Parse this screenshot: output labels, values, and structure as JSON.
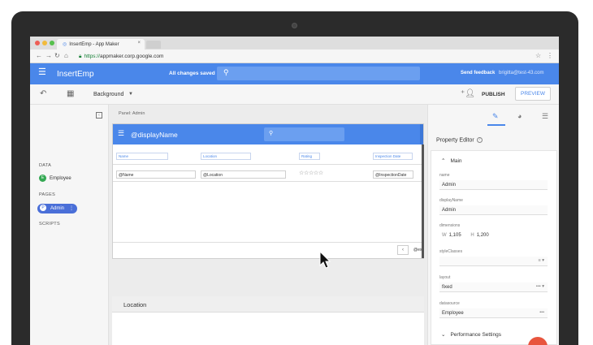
{
  "browser": {
    "tab_title": "InsertEmp - App Maker",
    "tab_icon": "app-maker-icon",
    "tab_close": "×",
    "url_scheme": "https://",
    "url_rest": "appmaker.corp.google.com",
    "traffic_colors": [
      "#ee5e56",
      "#f2bb3b",
      "#56c04d"
    ]
  },
  "app_header": {
    "title": "InsertEmp",
    "status": "All changes saved",
    "feedback": "Send feedback",
    "account": "brigitta@test-43.com",
    "color": "#4a87ea"
  },
  "toolbar": {
    "background_label": "Background",
    "publish": "PUBLISH",
    "preview": "PREVIEW"
  },
  "sidebar": {
    "data_heading": "DATA",
    "data_items": [
      {
        "badge": "E",
        "label": "Employee",
        "badge_color": "#34a853"
      }
    ],
    "pages_heading": "PAGES",
    "page_items": [
      {
        "badge": "P",
        "label": "Admin"
      }
    ],
    "scripts_heading": "SCRIPTS"
  },
  "canvas": {
    "breadcrumb": "Panel: Admin",
    "panel_title": "@displayName",
    "columns": [
      "Name",
      "Location",
      "Rating",
      "Inspection Date"
    ],
    "row": {
      "name": "@Name",
      "location": "@Location",
      "rating": "☆☆☆☆☆",
      "date": "@InspectionDate"
    },
    "pager_text": "@exp",
    "section_label": "Location"
  },
  "property_editor": {
    "title": "Property Editor",
    "main_section": "Main",
    "fields": {
      "name_label": "name",
      "name_value": "Admin",
      "display_label": "displayName",
      "display_value": "Admin",
      "dimensions_label": "dimensions",
      "width_prefix": "W",
      "width_value": "1,105",
      "height_prefix": "H",
      "height_value": "1,200",
      "style_label": "styleClasses",
      "layout_label": "layout",
      "layout_value": "fixed",
      "datasource_label": "datasource",
      "datasource_value": "Employee"
    },
    "perf_section": "Performance Settings"
  }
}
